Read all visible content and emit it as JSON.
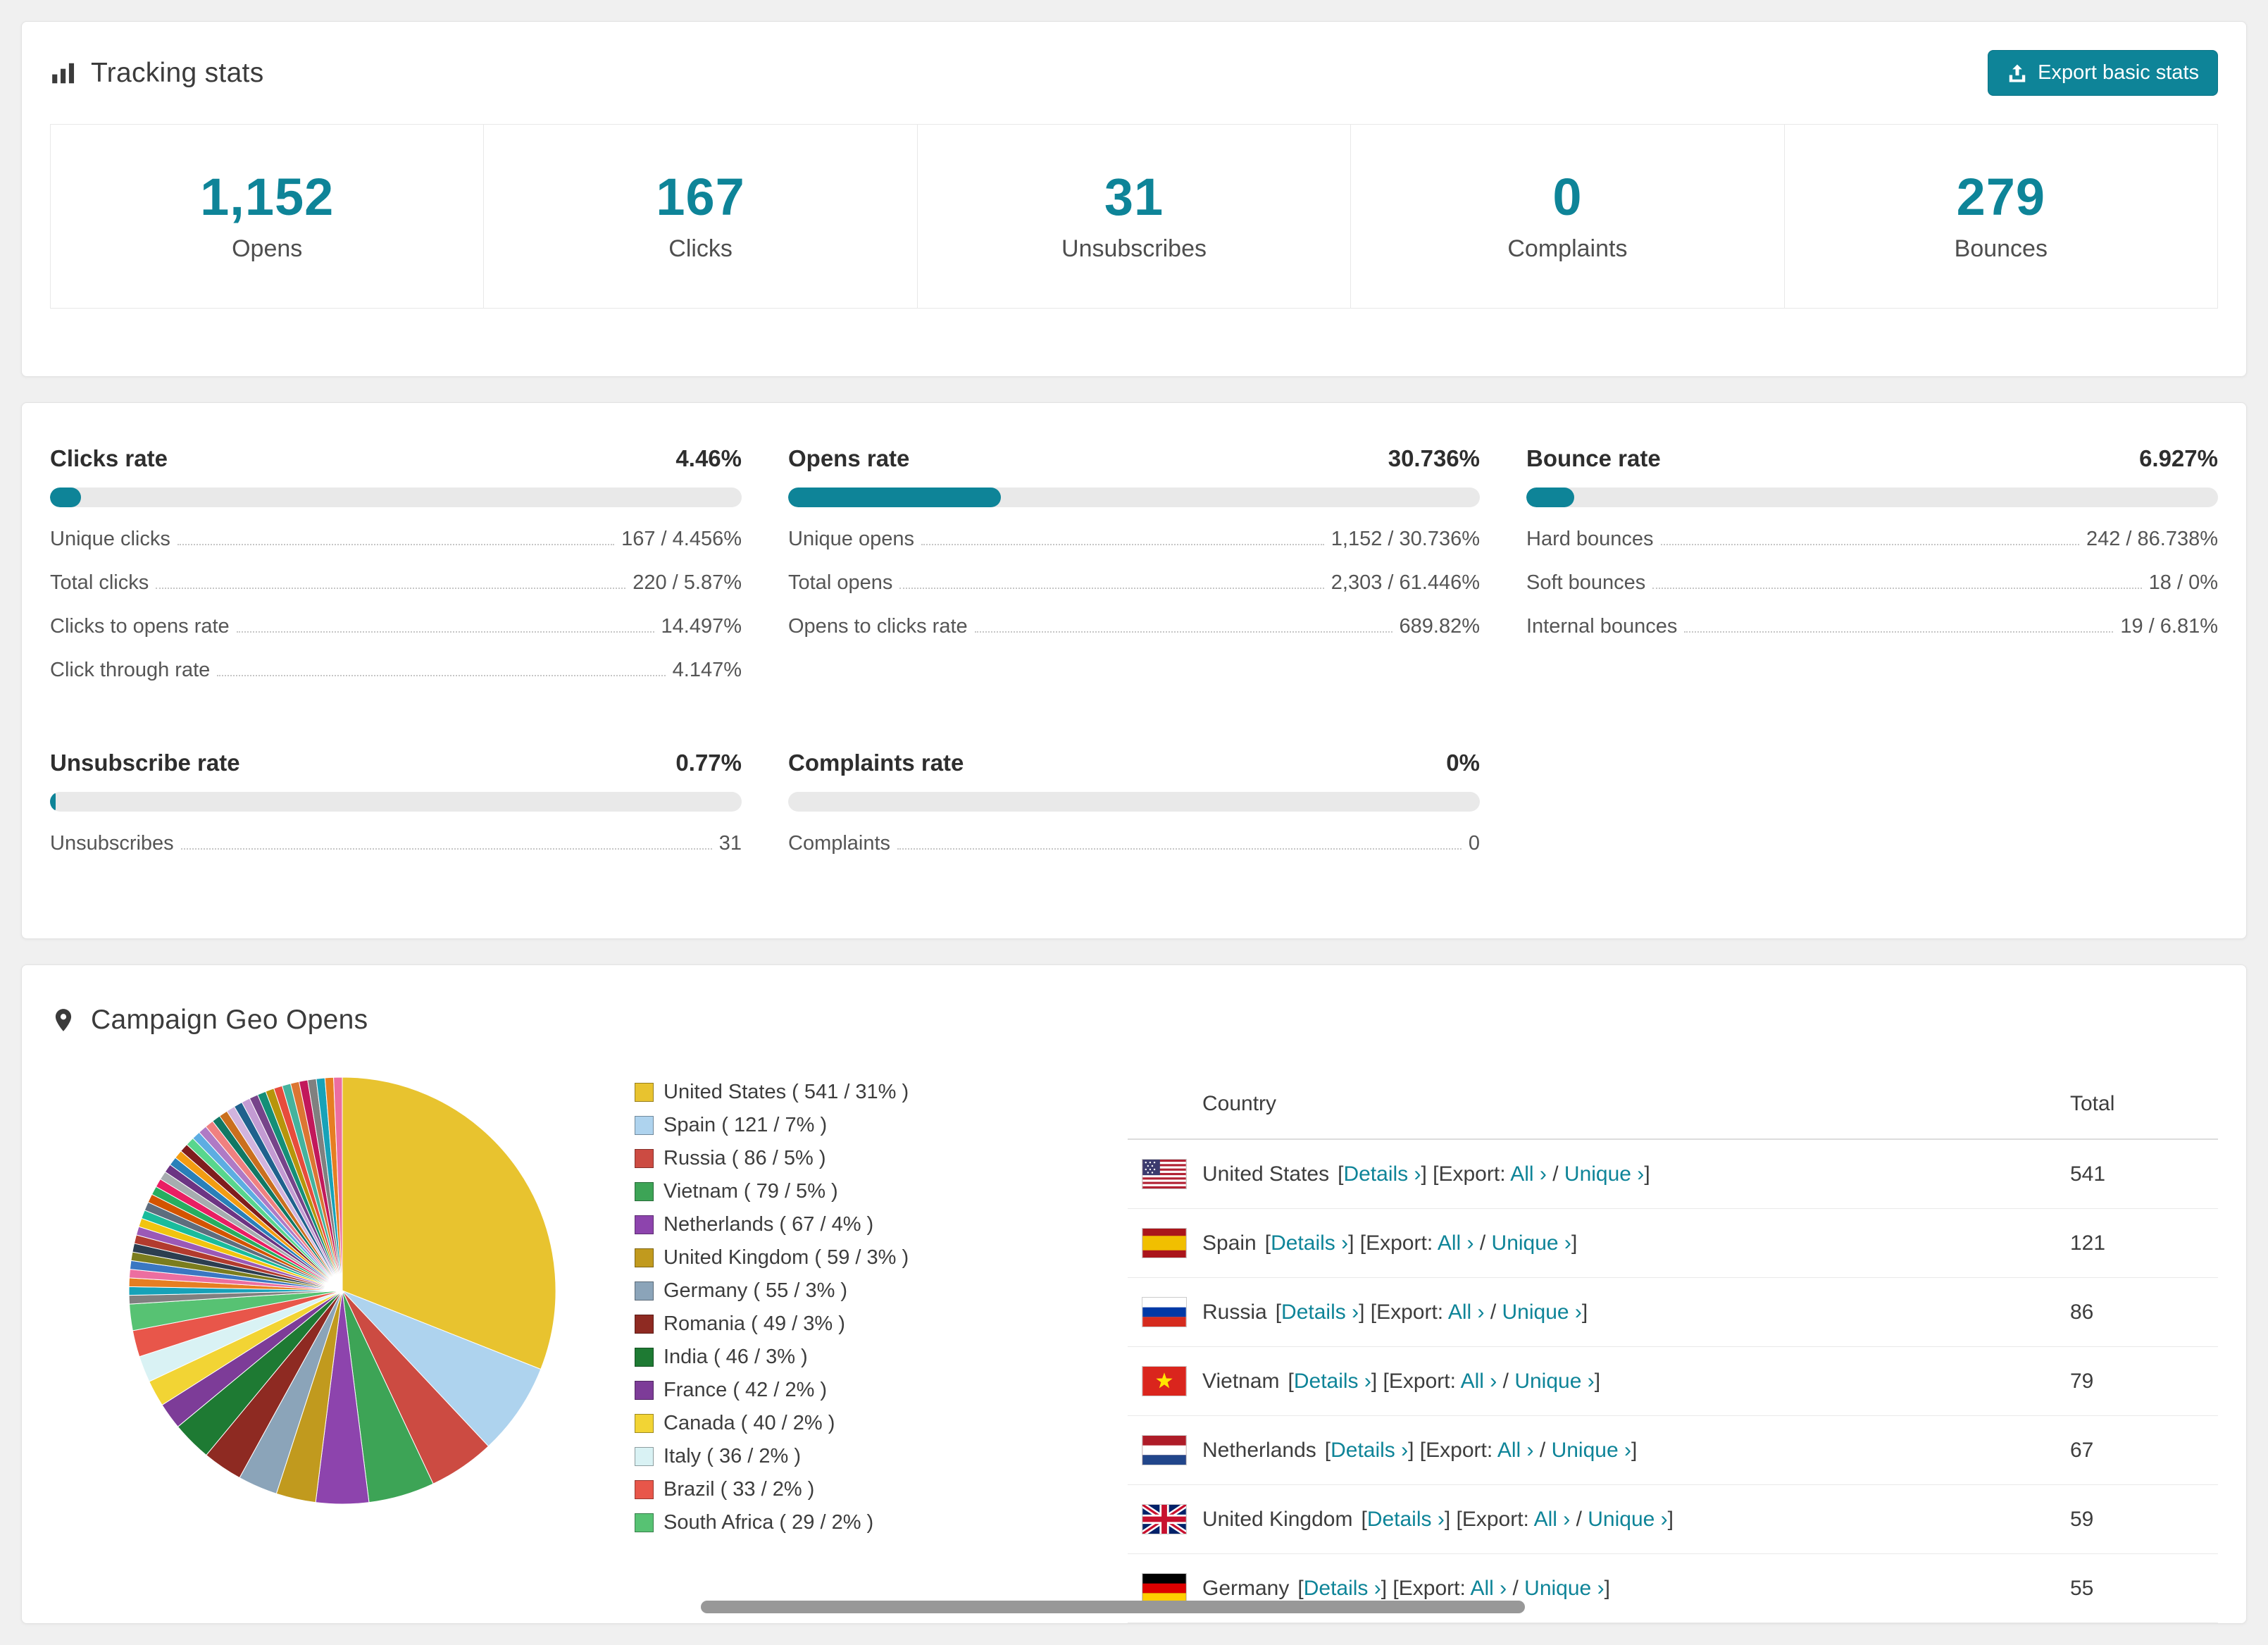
{
  "accent": "#0e8498",
  "tracking": {
    "title": "Tracking stats",
    "export_button": "Export basic stats",
    "stats": [
      {
        "value": "1,152",
        "label": "Opens"
      },
      {
        "value": "167",
        "label": "Clicks"
      },
      {
        "value": "31",
        "label": "Unsubscribes"
      },
      {
        "value": "0",
        "label": "Complaints"
      },
      {
        "value": "279",
        "label": "Bounces"
      }
    ]
  },
  "rates": {
    "blocks": [
      {
        "title": "Clicks rate",
        "percent": "4.46%",
        "fill": 4.46,
        "rows": [
          {
            "label": "Unique clicks",
            "value": "167 / 4.456%"
          },
          {
            "label": "Total clicks",
            "value": "220 / 5.87%"
          },
          {
            "label": "Clicks to opens rate",
            "value": "14.497%"
          },
          {
            "label": "Click through rate",
            "value": "4.147%"
          }
        ]
      },
      {
        "title": "Opens rate",
        "percent": "30.736%",
        "fill": 30.736,
        "rows": [
          {
            "label": "Unique opens",
            "value": "1,152 / 30.736%"
          },
          {
            "label": "Total opens",
            "value": "2,303 / 61.446%"
          },
          {
            "label": "Opens to clicks rate",
            "value": "689.82%"
          }
        ]
      },
      {
        "title": "Bounce rate",
        "percent": "6.927%",
        "fill": 6.927,
        "rows": [
          {
            "label": "Hard bounces",
            "value": "242 / 86.738%"
          },
          {
            "label": "Soft bounces",
            "value": "18 / 0%"
          },
          {
            "label": "Internal bounces",
            "value": "19 / 6.81%"
          }
        ]
      },
      {
        "title": "Unsubscribe rate",
        "percent": "0.77%",
        "fill": 0.77,
        "rows": [
          {
            "label": "Unsubscribes",
            "value": "31"
          }
        ]
      },
      {
        "title": "Complaints rate",
        "percent": "0%",
        "fill": 0,
        "rows": [
          {
            "label": "Complaints",
            "value": "0"
          }
        ]
      }
    ]
  },
  "geo": {
    "title": "Campaign Geo Opens",
    "table": {
      "headers": {
        "country": "Country",
        "total": "Total"
      },
      "details_label": "Details ›",
      "export_label": "Export:",
      "all_label": "All ›",
      "unique_label": "Unique ›",
      "rows": [
        {
          "country": "United States",
          "flag": "us",
          "total": "541"
        },
        {
          "country": "Spain",
          "flag": "es",
          "total": "121"
        },
        {
          "country": "Russia",
          "flag": "ru",
          "total": "86"
        },
        {
          "country": "Vietnam",
          "flag": "vn",
          "total": "79"
        },
        {
          "country": "Netherlands",
          "flag": "nl",
          "total": "67"
        },
        {
          "country": "United Kingdom",
          "flag": "gb",
          "total": "59"
        },
        {
          "country": "Germany",
          "flag": "de",
          "total": "55"
        }
      ]
    }
  },
  "chart_data": {
    "type": "pie",
    "title": "Campaign Geo Opens",
    "slices": [
      {
        "label": "United States",
        "value": 541,
        "percent": 31,
        "color": "#e8c32f"
      },
      {
        "label": "Spain",
        "value": 121,
        "percent": 7,
        "color": "#aed3ee"
      },
      {
        "label": "Russia",
        "value": 86,
        "percent": 5,
        "color": "#cc4b42"
      },
      {
        "label": "Vietnam",
        "value": 79,
        "percent": 5,
        "color": "#3da456"
      },
      {
        "label": "Netherlands",
        "value": 67,
        "percent": 4,
        "color": "#8d44ad"
      },
      {
        "label": "United Kingdom",
        "value": 59,
        "percent": 3,
        "color": "#c19a1e"
      },
      {
        "label": "Germany",
        "value": 55,
        "percent": 3,
        "color": "#8ba4b9"
      },
      {
        "label": "Romania",
        "value": 49,
        "percent": 3,
        "color": "#8e2a22"
      },
      {
        "label": "India",
        "value": 46,
        "percent": 3,
        "color": "#1e7a33"
      },
      {
        "label": "France",
        "value": 42,
        "percent": 2,
        "color": "#7d3c98"
      },
      {
        "label": "Canada",
        "value": 40,
        "percent": 2,
        "color": "#f2d434"
      },
      {
        "label": "Italy",
        "value": 36,
        "percent": 2,
        "color": "#d9f2f4"
      },
      {
        "label": "Brazil",
        "value": 33,
        "percent": 2,
        "color": "#e8564a"
      },
      {
        "label": "South Africa",
        "value": 29,
        "percent": 2,
        "color": "#57c273"
      }
    ],
    "others_percent": 26,
    "others_slice_count": 40,
    "others_colors": [
      "#808080",
      "#17a2b8",
      "#e67e22",
      "#ec6ea0",
      "#3a77c2",
      "#7b7d1e",
      "#2c3e50",
      "#b23b2e",
      "#9b59b6",
      "#f1c40f",
      "#1abc9c",
      "#5d6d7e",
      "#d35400",
      "#27ae60",
      "#e91e63",
      "#a6acaf",
      "#6c3483",
      "#2980b9",
      "#f39c12",
      "#7f1d1d",
      "#58d68d",
      "#5dade2",
      "#af7ac5",
      "#f08080",
      "#117864",
      "#ca6f1e",
      "#d2b4de",
      "#1f618d",
      "#c39bd3",
      "#76448a",
      "#148f77",
      "#b7950b",
      "#e74c3c",
      "#45b39d",
      "#dc7633",
      "#c2185b"
    ]
  }
}
